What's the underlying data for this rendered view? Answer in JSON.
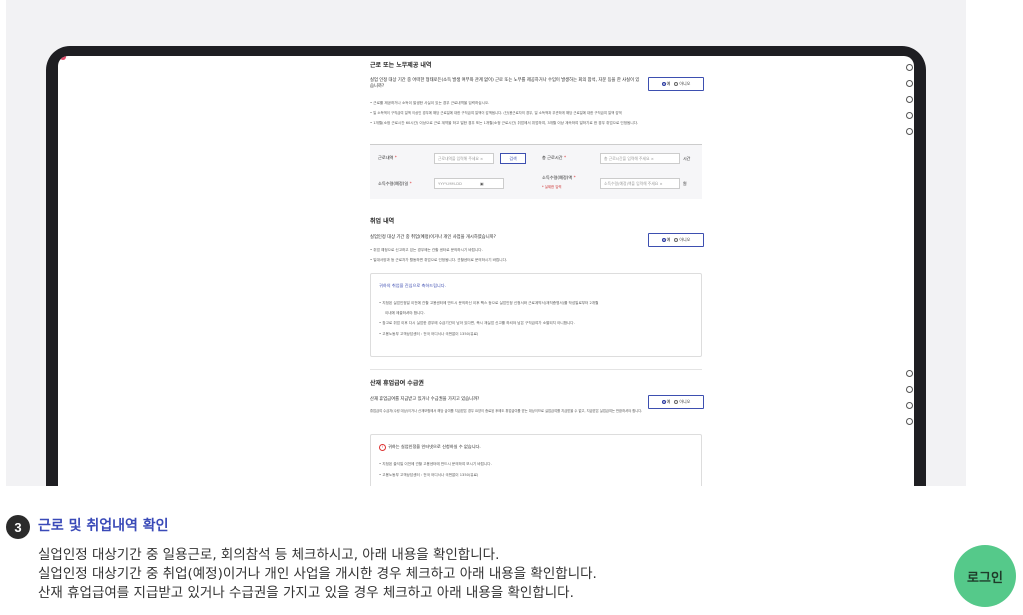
{
  "screenshot": {
    "section1": {
      "title": "근로 또는 노무제공 내역",
      "question": "실업 인정 대상 기간 중 어떠한 형태로든(소득 발생 여부와 관계 없이) 근로 또는 노무를 제공하거나 수입이 발생하는 회의 참석, 자문 등을 한 사실이 있습니까?",
      "yes": "예",
      "no": "아니오",
      "bullets": [
        "근로를 제공하거나 소득이 발생한 사실이 있는 경우 근로내역을 입력하십시오.",
        "일 소득액이 구직급여 일액 이상인 경우에 해당 근로일에 대한 구직급여 일액이 감액됩니다. (단)용근로자의 경우, 일 소득액과 무관하게 해당 근로일에 대한 구직급여 일액 감액",
        "1개월(소정 근로시간 60시간) 이상으로 근로 계약을 하고 일한 경우 또는 1개월(소정 근로시간) 취업에서 취업하여, 3개월 이상 계속하여 일하기로 한 경우 취업으로 인정됩니다."
      ],
      "form": {
        "work_label": "근로내역",
        "work_placeholder": "근로내역을 입력해 주세요",
        "work_button": "검색",
        "hours_label": "총 근로시간",
        "hours_placeholder": "총 근로시간을 입력해 주세요",
        "hours_unit": "시간",
        "date_label": "소득수령(예정)일",
        "date_placeholder": "YYYY-MM-DD",
        "amount_label": "소득수령(예정)액",
        "amount_note": "* 실제한 입력",
        "amount_placeholder": "소득수령(예정)액을 입력해 주세요",
        "amount_unit": "원"
      }
    },
    "section2": {
      "title": "취업 내역",
      "question": "실업인정 대상 기간 중 취업(예정)이거나 개인 사업을 개시하였습니까?",
      "yes": "예",
      "no": "아니오",
      "bullets": [
        "취업 예정으로 신고하고 있는 경우에는 관할 센터로 문의하시기 바랍니다.",
        "일대서양과 등 근로자가 활동하면 취업으로 인정됩니다. 관할센터로 문의하시기 바랍니다."
      ],
      "info_title": "귀하의 취업을 진심으로 축하드립니다.",
      "info_bullets": [
        "지정된 실업인정일 이전에 관할 고용센터에 반드시 문의하신 이후 팩스 등으로 실업인정 신청서와 근로계약서(재직증명서)를 작성일로부터 2개월",
        "이내에 제출하셔야 합니다.",
        "참고로 취업 이후 다시 실업한 경우에 수급기간이 남아 있다면, 즉시 재실업 신고를 하셔야 남은 구직급여가 소멸되지 아니합니다.",
        "고용노동부 고객상담센터 : 전국 어디서나 국번없이 1350(유료)"
      ]
    },
    "section3": {
      "title": "산재 휴업급여 수급권",
      "question": "산재 휴업급여를 지급받고 있거나 수급권을 가지고 있습니까?",
      "yes": "예",
      "no": "아니오",
      "desc": "휴업급여 수급자(수령 대상)이거나 산재보험에서 해당 급여를 지급받은 경우 요양이 종료된 후에도 휴업급여를 받는 대상이므로 실업급여를 지급받을 수 없고, 지급받은 실업급여는 반환하셔야 합니다.",
      "warn_title": "귀하는 실업인정을 인터넷으로 신청하실 수 없습니다.",
      "warn_bullets": [
        "지정된 출석일 이전에 관할 고용센터에 반드시 문의하여 보시기 바랍니다.",
        "고용노동부 고객상담센터 : 전국 어디서나 국번없이 1350(유료)"
      ]
    }
  },
  "step": {
    "number": "3",
    "title": "근로 및 취업내역 확인",
    "lines": [
      "실업인정 대상기간 중 일용근로, 회의참석 등 체크하시고, 아래 내용을 확인합니다.",
      "실업인정 대상기간 중 취업(예정)이거나 개인 사업을 개시한 경우 체크하고 아래 내용을 확인합니다.",
      "산재 휴업급여를 지급받고 있거나 수급권을 가지고 있을 경우 체크하고 아래 내용을 확인합니다."
    ]
  },
  "login_button": "로그인",
  "colors": {
    "accent": "#3a4ab8",
    "login_bg": "#55c98a",
    "badge_bg": "#2b2b2b"
  },
  "icons": [
    "calendar-icon",
    "warning-icon",
    "clear-icon"
  ]
}
